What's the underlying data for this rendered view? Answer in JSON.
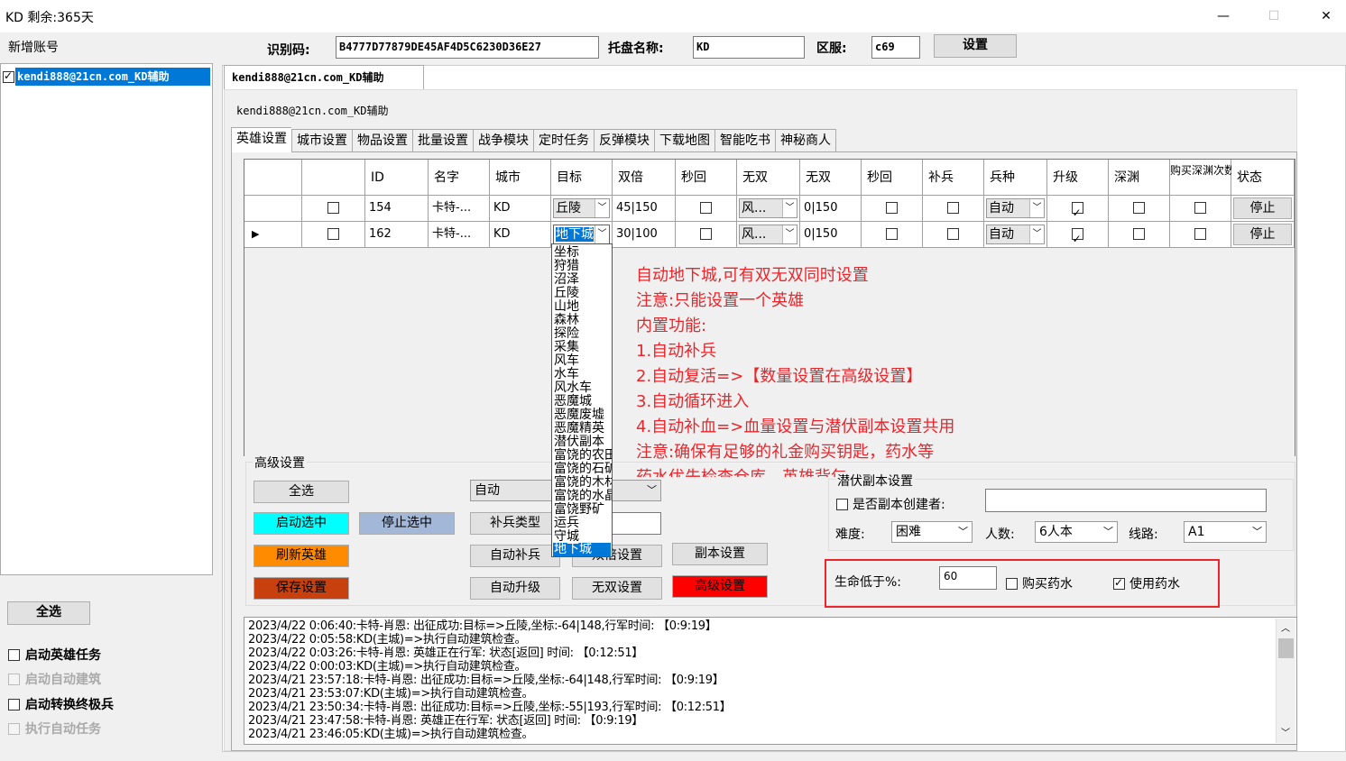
{
  "window": {
    "title": "KD 剩余:365天",
    "minimize_label": "—",
    "maximize_label": "☐",
    "close_label": "✕"
  },
  "header": {
    "add_account_label": "新增账号",
    "id_code_label": "识别码:",
    "id_code_value": "B4777D77879DE45AF4D5C6230D36E27",
    "host_name_label": "托盘名称:",
    "host_name_value": "KD",
    "server_label": "区服:",
    "server_value": "c69",
    "settings_button": "设置"
  },
  "sidebar": {
    "account": {
      "label": "kendi888@21cn.com_KD辅助",
      "checked": true
    },
    "select_all_button": "全选",
    "options": [
      {
        "label": "启动英雄任务",
        "enabled": true
      },
      {
        "label": "启动自动建筑",
        "enabled": false
      },
      {
        "label": "启动转换终极兵",
        "enabled": true
      },
      {
        "label": "执行自动任务",
        "enabled": false
      }
    ]
  },
  "main": {
    "account_tab": "kendi888@21cn.com_KD辅助",
    "group_title": "kendi888@21cn.com_KD辅助",
    "tabs": [
      "英雄设置",
      "城市设置",
      "物品设置",
      "批量设置",
      "战争模块",
      "定时任务",
      "反弹模块",
      "下载地图",
      "智能吃书",
      "神秘商人"
    ],
    "grid": {
      "columns": [
        "",
        "",
        "ID",
        "名字",
        "城市",
        "目标",
        "双倍",
        "秒回",
        "无双",
        "无双",
        "秒回",
        "补兵",
        "兵种",
        "升级",
        "深渊",
        "购买深渊次数",
        "状态"
      ],
      "rows": [
        {
          "id": "154",
          "name": "卡特-...",
          "city": "KD",
          "target": "丘陵",
          "double": "45|150",
          "wushuang": "风...",
          "wushuang_count": "0|150",
          "troop": "自动",
          "status": "停止"
        },
        {
          "id": "162",
          "name": "卡特-...",
          "city": "KD",
          "target": "地下城",
          "double": "30|100",
          "wushuang": "风...",
          "wushuang_count": "0|150",
          "troop": "自动",
          "status": "停止"
        }
      ]
    },
    "dropdown_items": [
      "坐标",
      "狩猎",
      "沼泽",
      "丘陵",
      "山地",
      "森林",
      "探险",
      "采集",
      "风车",
      "水车",
      "风水车",
      "恶魔城",
      "恶魔废墟",
      "恶魔精英",
      "潜伏副本",
      "富饶的农田",
      "富饶的石矿",
      "富饶的木材",
      "富饶的水晶",
      "富饶野矿",
      "运兵",
      "守城",
      "地下城"
    ],
    "notes": [
      "自动地下城,可有双无双同时设置",
      "注意:只能设置一个英雄",
      "内置功能:",
      "1.自动补兵",
      "2.自动复活=>【数量设置在高级设置】",
      "3.自动循环进入",
      "4.自动补血=>血量设置与潜伏副本设置共用",
      "注意:确保有足够的礼金购买钥匙，药水等",
      "药水优先检查仓库，英雄背包"
    ],
    "advanced": {
      "title": "高级设置",
      "select_all": "全选",
      "start_selected": "启动选中",
      "stop_selected": "停止选中",
      "refresh_heroes": "刷新英雄",
      "save_settings": "保存设置",
      "auto_combo": "自动",
      "troop_type": "补兵类型",
      "auto_reinforce": "自动补兵",
      "double_settings": "双倍设置",
      "auto_upgrade": "自动升级",
      "wushuang_settings": "无双设置",
      "dungeon_settings": "副本设置",
      "advanced_settings": "高级设置"
    },
    "dungeon": {
      "title": "潜伏副本设置",
      "is_creator_label": "是否副本创建者:",
      "creator_value": "",
      "difficulty_label": "难度:",
      "difficulty_value": "困难",
      "people_label": "人数:",
      "people_value": "6人本",
      "route_label": "线路:",
      "route_value": "A1",
      "hp_label": "生命低于%:",
      "hp_value": "60",
      "buy_potion_label": "购买药水",
      "buy_potion_checked": false,
      "use_potion_label": "使用药水",
      "use_potion_checked": true
    },
    "log": [
      "2023/4/22 0:06:40:卡特-肖恩: 出征成功:目标=>丘陵,坐标:-64|148,行军时间: 【0:9:19】",
      "2023/4/22 0:05:58:KD(主城)=>执行自动建筑检查。",
      "2023/4/22 0:03:26:卡特-肖恩: 英雄正在行军: 状态[返回] 时间: 【0:12:51】",
      "2023/4/22 0:00:03:KD(主城)=>执行自动建筑检查。",
      "2023/4/21 23:57:18:卡特-肖恩: 出征成功:目标=>丘陵,坐标:-64|148,行军时间: 【0:9:19】",
      "2023/4/21 23:53:07:KD(主城)=>执行自动建筑检查。",
      "2023/4/21 23:50:34:卡特-肖恩: 出征成功:目标=>丘陵,坐标:-55|193,行军时间: 【0:12:51】",
      "2023/4/21 23:47:58:卡特-肖恩: 英雄正在行军: 状态[返回] 时间: 【0:9:19】",
      "2023/4/21 23:46:05:KD(主城)=>执行自动建筑检查。"
    ]
  },
  "colors": {
    "accent": "#0078d7",
    "note_red": "#e8262c"
  }
}
